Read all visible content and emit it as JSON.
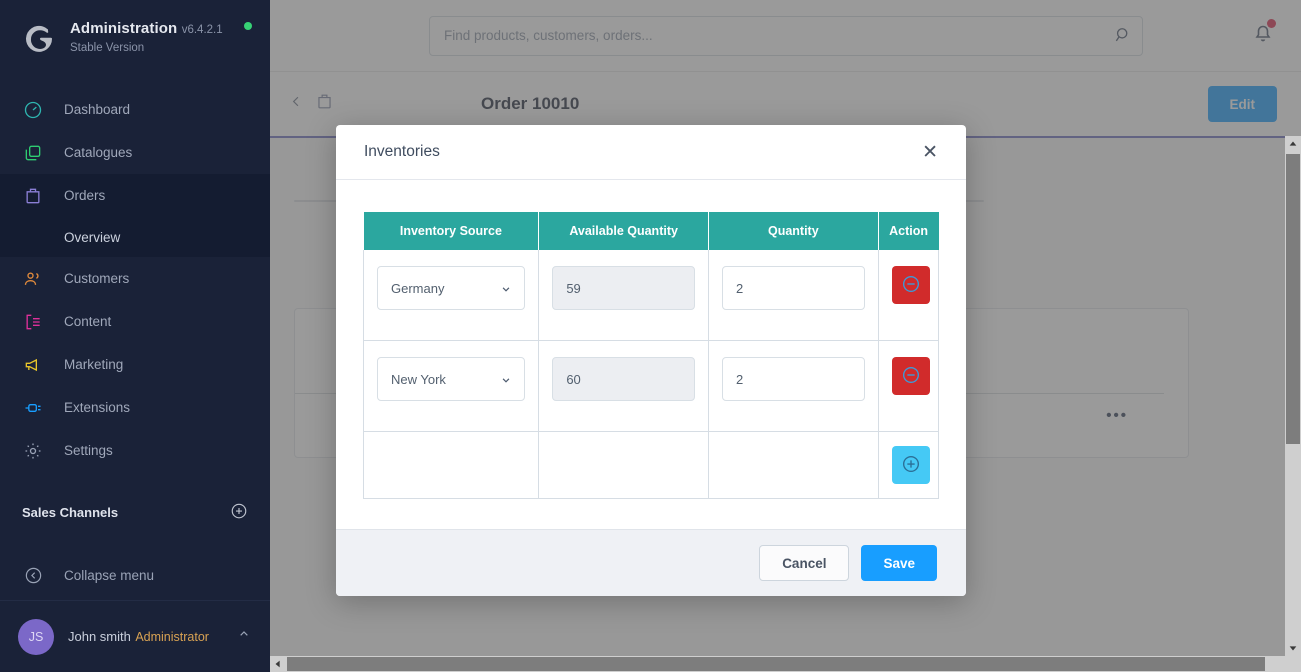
{
  "sidebar": {
    "brand": {
      "logo_icon": "shopware-logo-icon",
      "title": "Administration",
      "version": "v6.4.2.1 Stable Version",
      "status_dot_color": "#37d275"
    },
    "items": [
      {
        "label": "Dashboard",
        "icon": "dashboard-gauge-icon",
        "color": "#2eb5b0",
        "active": false
      },
      {
        "label": "Catalogues",
        "icon": "catalogues-copy-icon",
        "color": "#2ecc71",
        "active": false
      },
      {
        "label": "Orders",
        "icon": "orders-bag-icon",
        "color": "#8b7fd6",
        "active": true
      },
      {
        "label": "Customers",
        "icon": "customers-people-icon",
        "color": "#e08a3c",
        "active": false
      },
      {
        "label": "Content",
        "icon": "content-layout-icon",
        "color": "#e0309b",
        "active": false
      },
      {
        "label": "Marketing",
        "icon": "marketing-megaphone-icon",
        "color": "#e8c52b",
        "active": false
      },
      {
        "label": "Extensions",
        "icon": "extensions-plug-icon",
        "color": "#189eff",
        "active": false
      },
      {
        "label": "Settings",
        "icon": "settings-gear-icon",
        "color": "#9aa3b6",
        "active": false
      }
    ],
    "sub_item": {
      "label": "Overview",
      "parent": "Orders"
    },
    "section": {
      "label": "Sales Channels",
      "add_icon": "plus-circle-icon"
    },
    "collapse": {
      "label": "Collapse menu",
      "icon": "collapse-chevron-icon"
    },
    "user": {
      "initials": "JS",
      "name": "John smith",
      "role": "Administrator",
      "caret_icon": "chevron-up-icon"
    }
  },
  "topbar": {
    "search": {
      "placeholder": "Find products, customers, orders...",
      "value": "",
      "icon": "search-icon"
    },
    "notifications": {
      "icon": "bell-icon",
      "has_unread": true,
      "badge_color": "#de294c"
    }
  },
  "pagehead": {
    "back_icon": "chevron-left-icon",
    "module_icon": "orders-bag-icon",
    "title": "Order 10010",
    "edit_label": "Edit",
    "accent_color": "#6d6ec0"
  },
  "modal": {
    "title": "Inventories",
    "close_icon": "close-x-icon",
    "header_color": "#2ba79f",
    "table": {
      "columns": [
        "Inventory Source",
        "Available Quantity",
        "Quantity",
        "Action"
      ],
      "rows": [
        {
          "inventory_source": "Germany",
          "available_quantity": "59",
          "quantity": "2",
          "action_icon": "minus-circle-icon",
          "action_color": "#d12b2b"
        },
        {
          "inventory_source": "New York",
          "available_quantity": "60",
          "quantity": "2",
          "action_icon": "minus-circle-icon",
          "action_color": "#d12b2b"
        }
      ],
      "add_row": {
        "action_icon": "plus-circle-icon",
        "action_color": "#45c9f5"
      }
    },
    "footer": {
      "cancel_label": "Cancel",
      "save_label": "Save",
      "save_color": "#189eff"
    }
  },
  "scrollbars": {
    "vertical": {
      "up_icon": "scroll-up-arrow-icon",
      "down_icon": "scroll-down-arrow-icon"
    },
    "horizontal": {
      "left_icon": "scroll-left-arrow-icon",
      "right_icon": "scroll-right-arrow-icon"
    }
  }
}
